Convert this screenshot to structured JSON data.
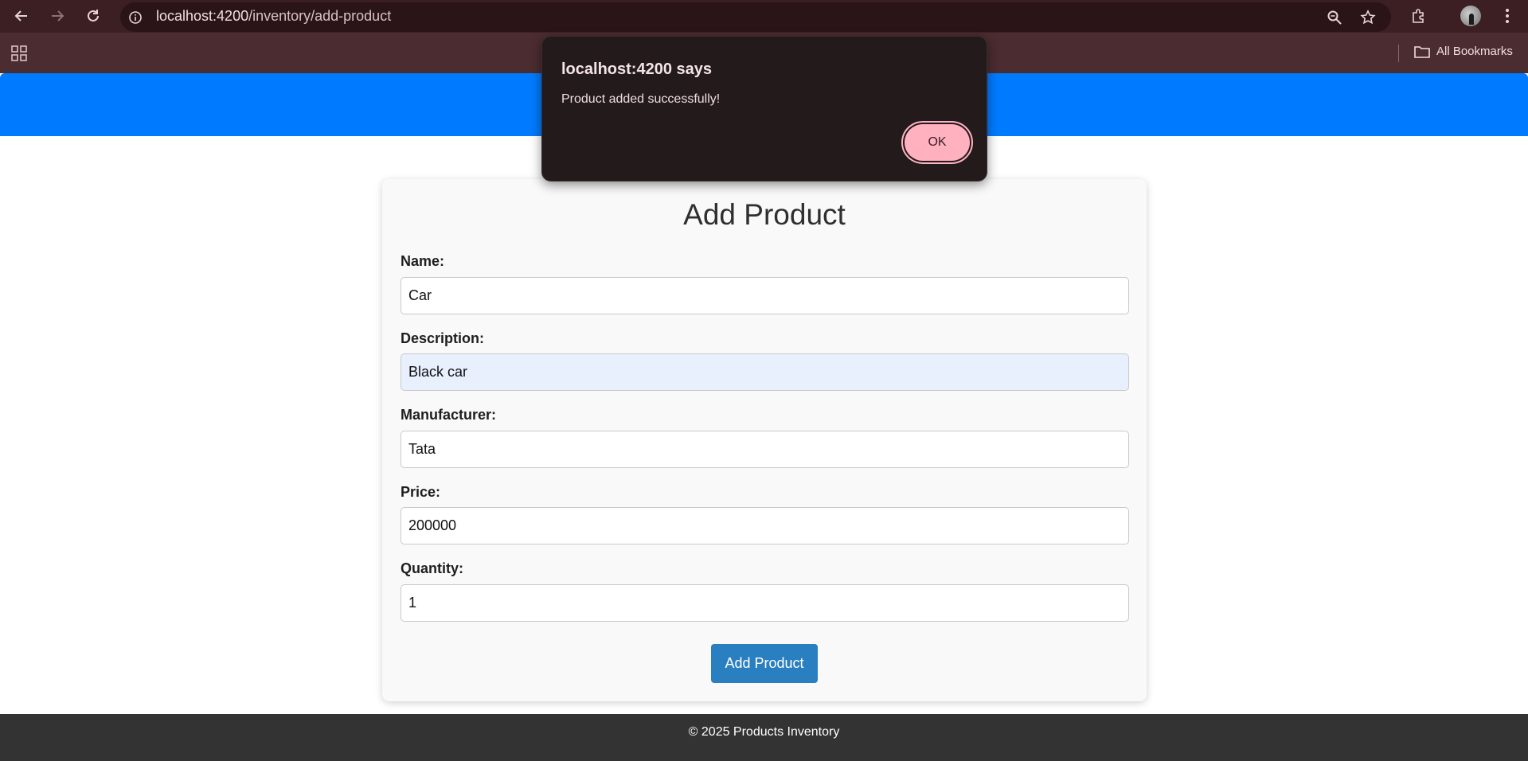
{
  "browser": {
    "url_host": "localhost:4200",
    "url_path": "/inventory/add-product",
    "bookmarks_label": "All Bookmarks"
  },
  "form": {
    "title": "Add Product",
    "fields": [
      {
        "label": "Name:",
        "value": "Car"
      },
      {
        "label": "Description:",
        "value": "Black car"
      },
      {
        "label": "Manufacturer:",
        "value": "Tata"
      },
      {
        "label": "Price:",
        "value": "200000"
      },
      {
        "label": "Quantity:",
        "value": "1"
      }
    ],
    "submit_label": "Add Product"
  },
  "footer": {
    "text": "© 2025 Products Inventory"
  },
  "dialog": {
    "title": "localhost:4200 says",
    "message": "Product added successfully!",
    "ok_label": "OK"
  },
  "colors": {
    "header_blue": "#007bff",
    "submit_blue": "#2a7fc1",
    "footer_dark": "#333333",
    "dialog_bg": "#231a1b",
    "ok_pink": "#ffb1c0"
  }
}
